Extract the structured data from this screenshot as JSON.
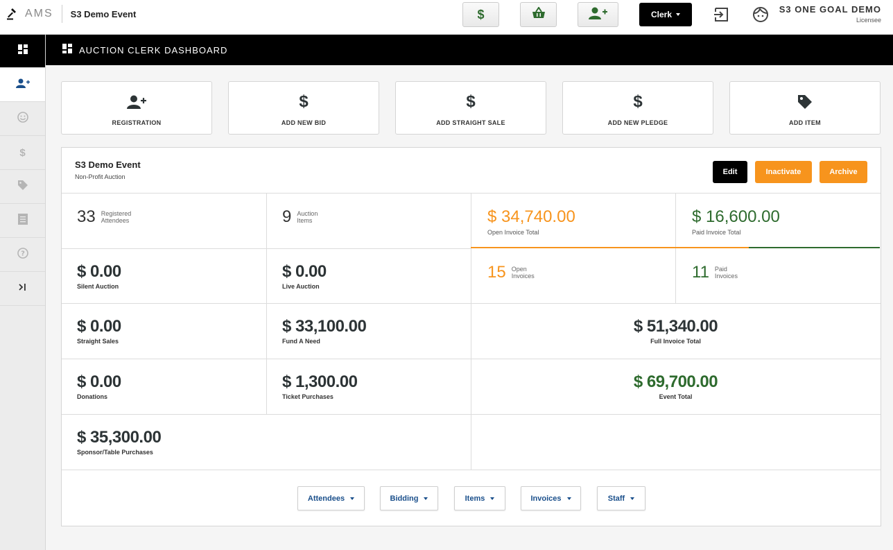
{
  "topbar": {
    "brand": "AMS",
    "event_name": "S3 Demo Event",
    "role_button": "Clerk",
    "org_name": "S3 ONE GOAL DEMO",
    "org_role": "Licensee",
    "icons": [
      "dollar-icon",
      "basket-icon",
      "user-plus-icon",
      "logout-icon",
      "avatar-face-icon"
    ]
  },
  "sidebar": {
    "items": [
      "dashboard-icon",
      "user-plus-icon",
      "smile-icon",
      "dollar-icon",
      "tag-icon",
      "list-icon",
      "help-icon",
      "expand-icon"
    ]
  },
  "header": {
    "title": "AUCTION CLERK DASHBOARD"
  },
  "actions": [
    {
      "label": "REGISTRATION",
      "icon": "user-plus-icon"
    },
    {
      "label": "ADD NEW BID",
      "icon": "dollar-icon"
    },
    {
      "label": "ADD STRAIGHT SALE",
      "icon": "dollar-icon"
    },
    {
      "label": "ADD NEW PLEDGE",
      "icon": "dollar-icon"
    },
    {
      "label": "ADD ITEM",
      "icon": "tag-icon"
    }
  ],
  "event": {
    "title": "S3 Demo Event",
    "subtitle": "Non-Profit Auction",
    "edit_label": "Edit",
    "inactivate_label": "Inactivate",
    "archive_label": "Archive"
  },
  "stats": {
    "registered_attendees": {
      "value": "33",
      "caption_1": "Registered",
      "caption_2": "Attendees"
    },
    "auction_items": {
      "value": "9",
      "caption_1": "Auction",
      "caption_2": "Items"
    },
    "open_invoice_total": {
      "value": "$ 34,740.00",
      "caption": "Open Invoice Total"
    },
    "paid_invoice_total": {
      "value": "$ 16,600.00",
      "caption": "Paid Invoice Total"
    },
    "open_invoices": {
      "value": "15",
      "caption_1": "Open",
      "caption_2": "Invoices"
    },
    "paid_invoices": {
      "value": "11",
      "caption_1": "Paid",
      "caption_2": "Invoices"
    },
    "silent_auction": {
      "value": "$ 0.00",
      "caption": "Silent Auction"
    },
    "live_auction": {
      "value": "$ 0.00",
      "caption": "Live Auction"
    },
    "straight_sales": {
      "value": "$ 0.00",
      "caption": "Straight Sales"
    },
    "fund_a_need": {
      "value": "$ 33,100.00",
      "caption": "Fund A Need"
    },
    "full_invoice_total": {
      "value": "$ 51,340.00",
      "caption": "Full Invoice Total"
    },
    "donations": {
      "value": "$ 0.00",
      "caption": "Donations"
    },
    "ticket_purchases": {
      "value": "$ 1,300.00",
      "caption": "Ticket Purchases"
    },
    "event_total": {
      "value": "$ 69,700.00",
      "caption": "Event Total"
    },
    "sponsor_table": {
      "value": "$ 35,300.00",
      "caption": "Sponsor/Table Purchases"
    }
  },
  "paid_fraction": 0.32,
  "menus": [
    "Attendees",
    "Bidding",
    "Items",
    "Invoices",
    "Staff"
  ],
  "colors": {
    "orange": "#f7941d",
    "green": "#2e6b2e",
    "link": "#1a4f8b"
  }
}
